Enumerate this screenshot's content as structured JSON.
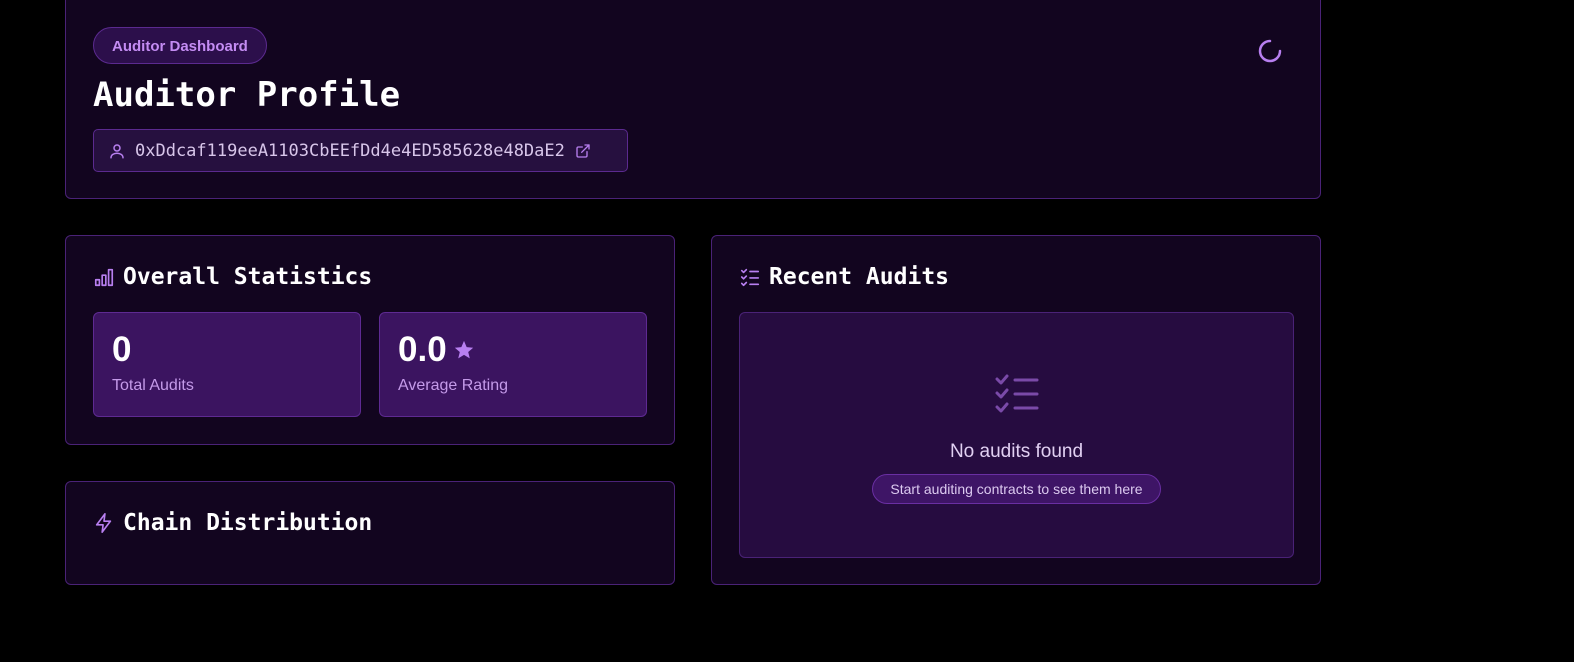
{
  "header": {
    "badge": "Auditor Dashboard",
    "title": "Auditor Profile",
    "address": "0xDdcaf119eeA1103CbEEfDd4e4ED585628e48DaE2"
  },
  "stats": {
    "title": "Overall Statistics",
    "total_audits_value": "0",
    "total_audits_label": "Total Audits",
    "average_rating_value": "0.0",
    "average_rating_label": "Average Rating"
  },
  "chain": {
    "title": "Chain Distribution"
  },
  "recent": {
    "title": "Recent Audits",
    "empty_title": "No audits found",
    "empty_hint": "Start auditing contracts to see them here"
  },
  "icons": {
    "user": "user-icon",
    "external_link": "external-link-icon",
    "loading": "loading-spinner-icon",
    "stats": "bar-chart-icon",
    "star": "star-icon",
    "chain": "lightning-icon",
    "audits": "checklist-icon"
  },
  "colors": {
    "background": "#000000",
    "card": "#12051f",
    "border": "#4a2277",
    "accent": "#b87ff0",
    "tile": "#3b1460"
  }
}
